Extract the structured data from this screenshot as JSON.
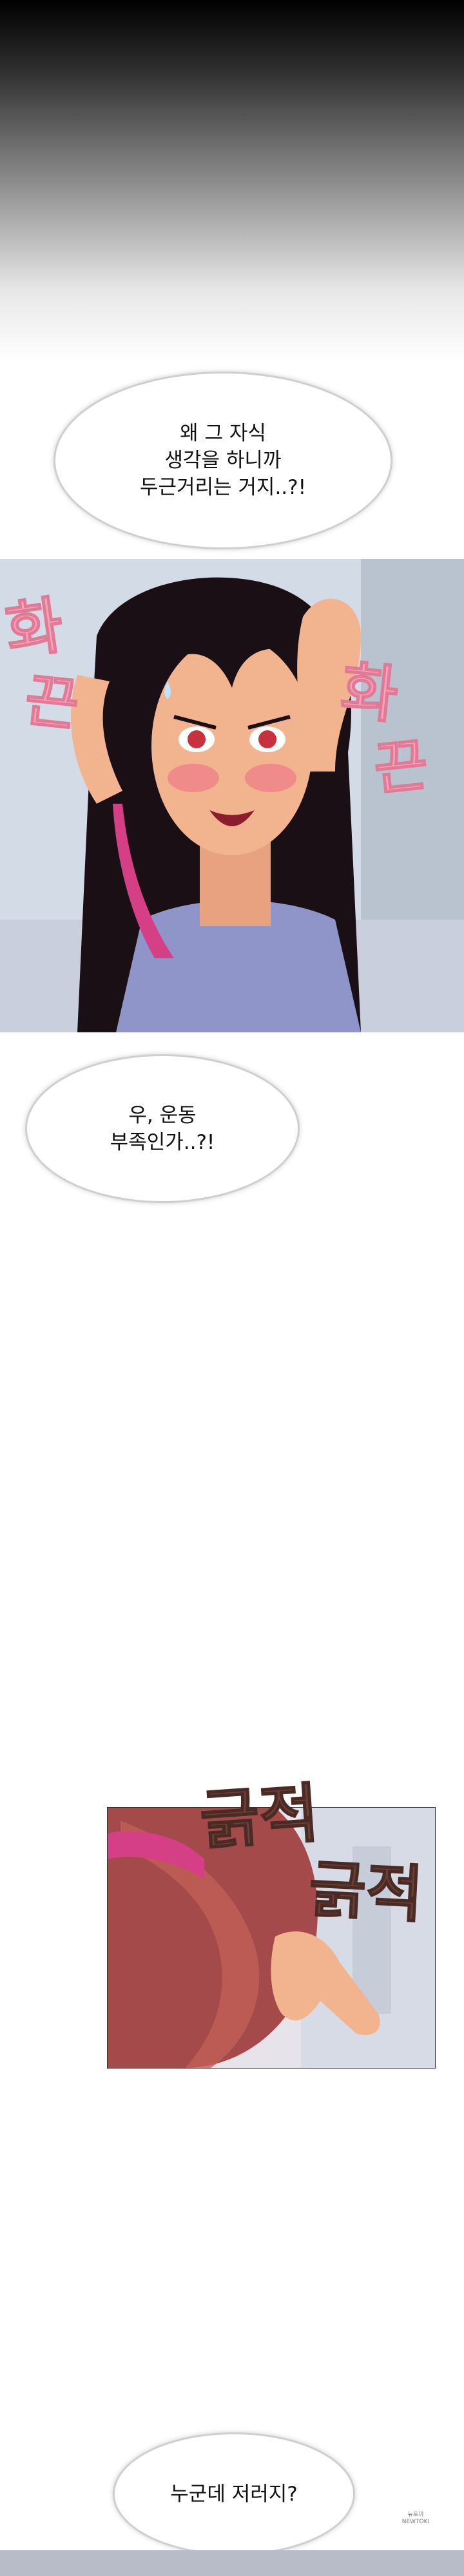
{
  "bubbles": {
    "b1": {
      "lines": [
        "왜 그 자식",
        "생각을 하니까",
        "두근거리는 거지..?!"
      ]
    },
    "b2": {
      "lines": [
        "우, 운동",
        "부족인가..?!"
      ]
    },
    "b3": {
      "lines": [
        "누군데 저러지?"
      ]
    }
  },
  "sfx": {
    "hwa_left": "화",
    "keun_left": "끈",
    "hwa_right": "화",
    "keun_right": "끈",
    "gul_top": "긁적",
    "gul_bottom": "긁적"
  },
  "watermark": {
    "lines": [
      "뉴토끼",
      "NEWTOKI"
    ]
  },
  "colors": {
    "sfx_pink": "#f6a3b8",
    "sfx_brown": "#6b3f36",
    "hair": "#1a0f14",
    "skin": "#f2b48f"
  }
}
